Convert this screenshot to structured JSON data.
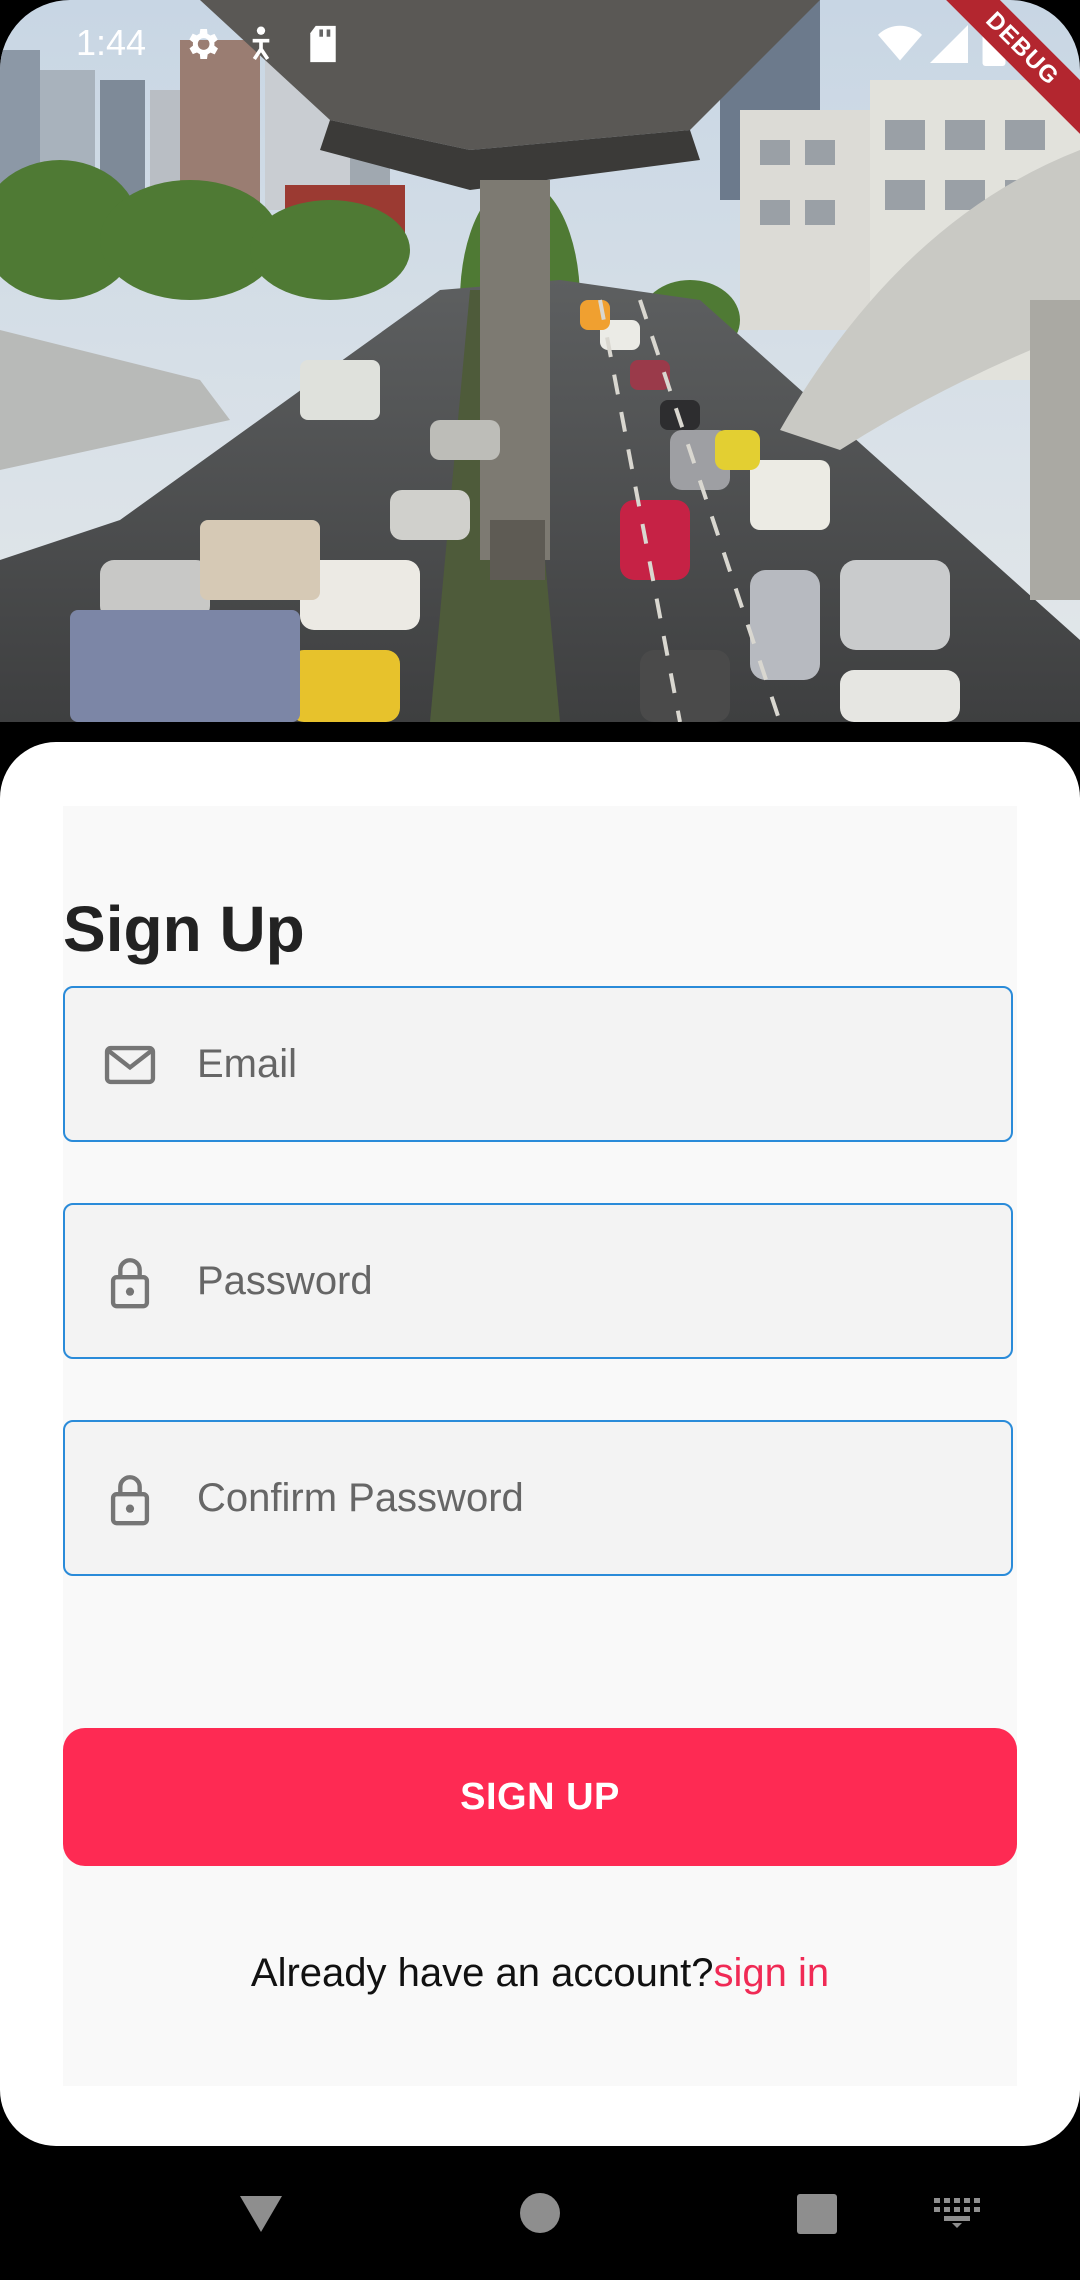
{
  "status_bar": {
    "time": "1:44",
    "left_icons": [
      "gear-icon",
      "accessibility-icon",
      "sd-card-icon"
    ],
    "right_icons": [
      "wifi-icon",
      "signal-icon",
      "battery-icon"
    ],
    "debug_banner": "DEBUG"
  },
  "hero": {
    "image": "city-traffic-photo"
  },
  "form": {
    "title": "Sign Up",
    "email": {
      "placeholder": "Email",
      "icon": "mail-icon"
    },
    "password": {
      "placeholder": "Password",
      "icon": "lock-icon"
    },
    "confirm_password": {
      "placeholder": "Confirm Password",
      "icon": "lock-icon"
    },
    "submit_label": "SIGN UP",
    "account_prompt": "Already have an account?",
    "signin_link": "sign in"
  },
  "nav_bar": {
    "buttons": [
      "back-icon",
      "home-icon",
      "recents-icon",
      "keyboard-icon"
    ]
  },
  "colors": {
    "accent": "#fe2a53",
    "field_border": "#2a8bd9",
    "link": "#f02a55"
  }
}
